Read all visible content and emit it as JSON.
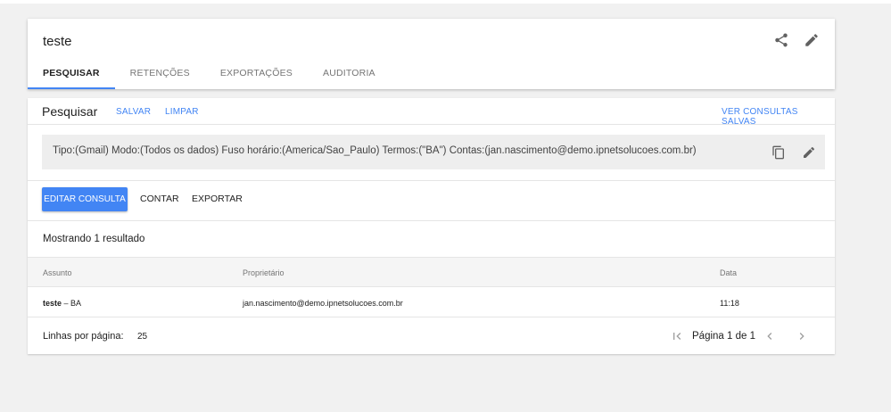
{
  "matter": {
    "title": "teste",
    "tabs": [
      {
        "label": "PESQUISAR",
        "active": true
      },
      {
        "label": "RETENÇÕES",
        "active": false
      },
      {
        "label": "EXPORTAÇÕES",
        "active": false
      },
      {
        "label": "AUDITORIA",
        "active": false
      }
    ]
  },
  "search": {
    "label": "Pesquisar",
    "save_link": "SALVAR",
    "clear_link": "LIMPAR",
    "saved_link": "VER CONSULTAS SALVAS",
    "query_text": "Tipo:(Gmail) Modo:(Todos os dados) Fuso horário:(America/Sao_Paulo) Termos:(\"BA\") Contas:(jan.nascimento@demo.ipnetsolucoes.com.br)",
    "edit_button": "EDITAR CONSULTA",
    "count_button": "CONTAR",
    "export_button": "EXPORTAR"
  },
  "results": {
    "summary": "Mostrando 1 resultado",
    "columns": [
      "Assunto",
      "Proprietário",
      "Data"
    ],
    "rows": [
      {
        "subject": "teste",
        "snippet": " – BA",
        "owner": "jan.nascimento@demo.ipnetsolucoes.com.br",
        "date": "11:18"
      }
    ],
    "rows_per_page_label": "Linhas por página:",
    "rows_per_page": "25",
    "page_label": "Página 1 de 1"
  },
  "colors": {
    "accent": "#4285f4",
    "background": "#f1f1f1",
    "query_box": "#eeeeee"
  },
  "icons": [
    "share-icon",
    "edit-icon",
    "copy-icon",
    "first-page-icon",
    "prev-page-icon",
    "next-page-icon"
  ]
}
